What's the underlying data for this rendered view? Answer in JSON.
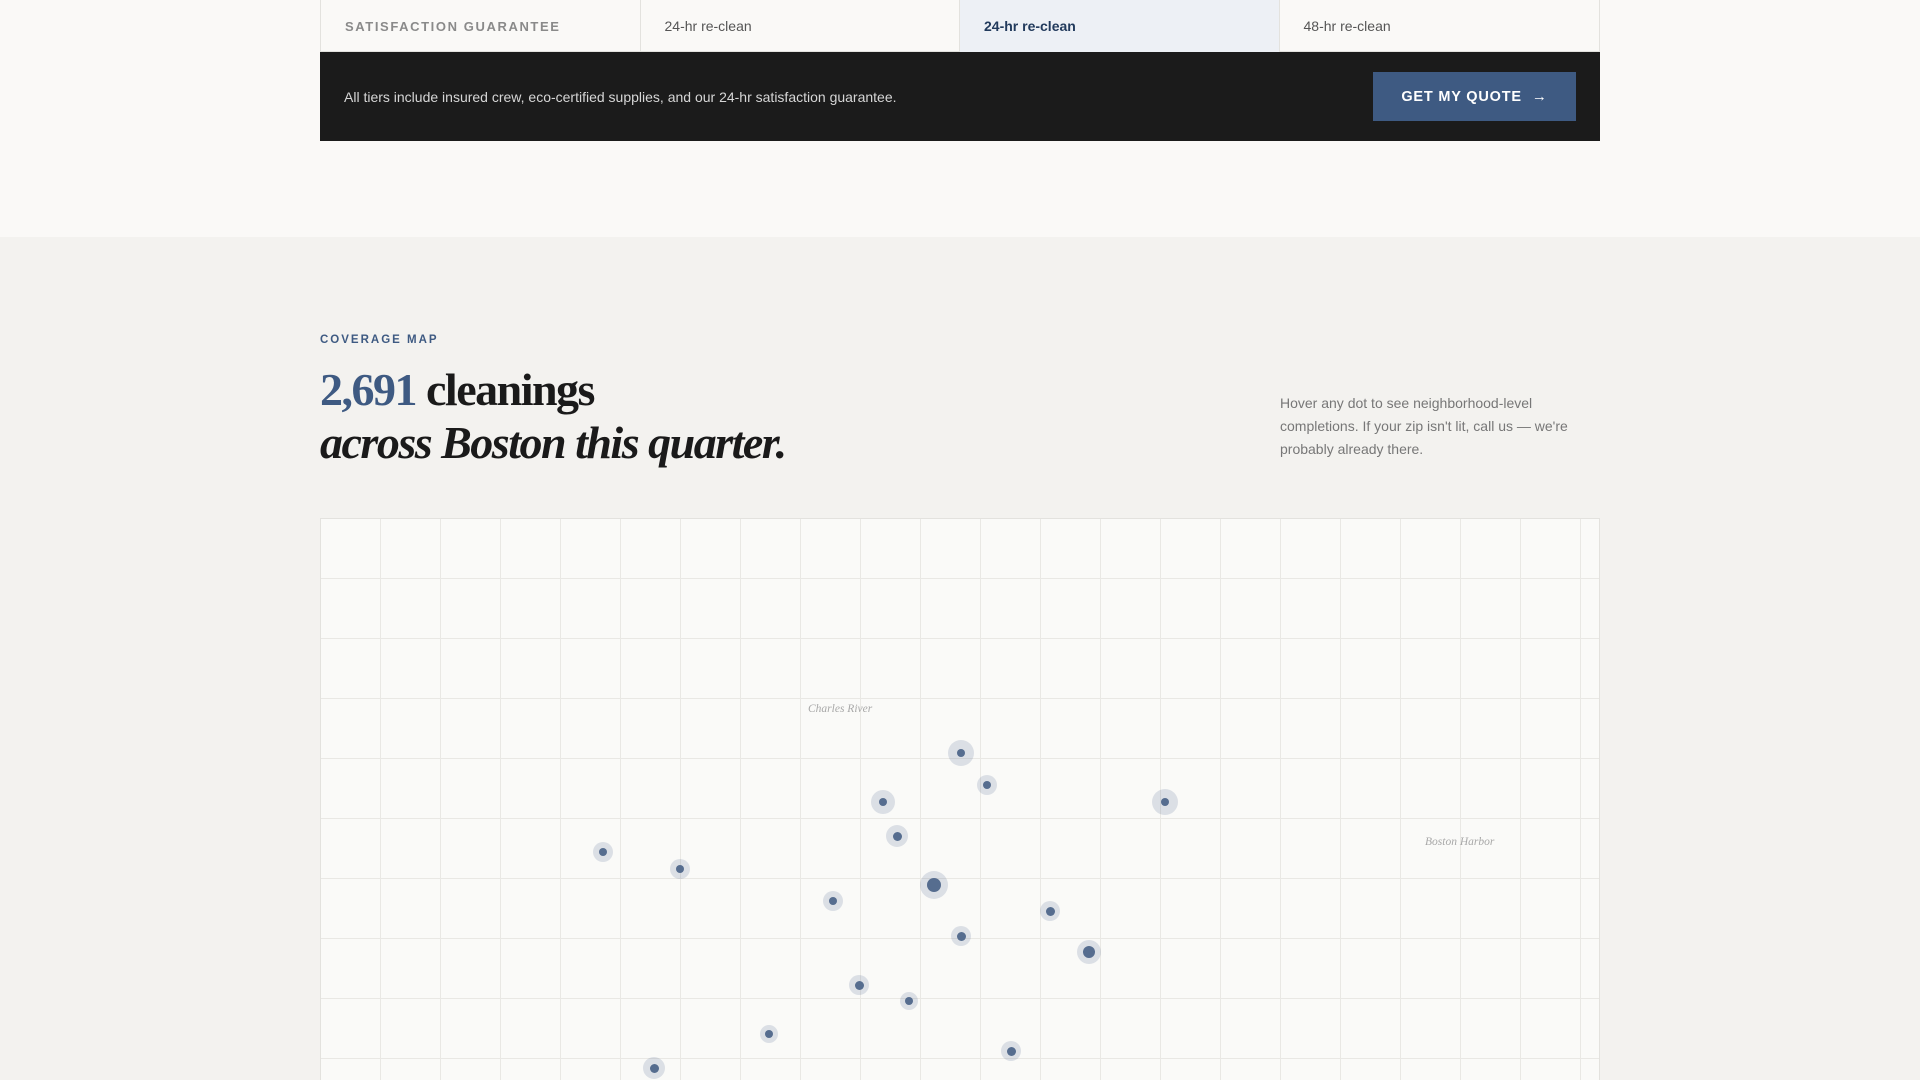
{
  "comparison": {
    "row_label": "SATISFACTION GUARANTEE",
    "values": [
      "24-hr re-clean",
      "24-hr re-clean",
      "48-hr re-clean"
    ]
  },
  "banner": {
    "text": "All tiers include insured crew, eco-certified supplies, and our 24-hr satisfaction guarantee.",
    "cta_label": "GET MY QUOTE",
    "cta_icon": "arrow-right-icon"
  },
  "coverage": {
    "eyebrow": "COVERAGE MAP",
    "count": "2,691",
    "headline_rest": " cleanings",
    "headline_line2": "across Boston this quarter.",
    "hint": "Hover any dot to see neighborhood-level completions. If your zip isn't lit, call us — we're probably already there."
  },
  "map": {
    "labels": [
      "Charles River",
      "Boston Harbor"
    ],
    "accent_color": "#3e5a82"
  }
}
